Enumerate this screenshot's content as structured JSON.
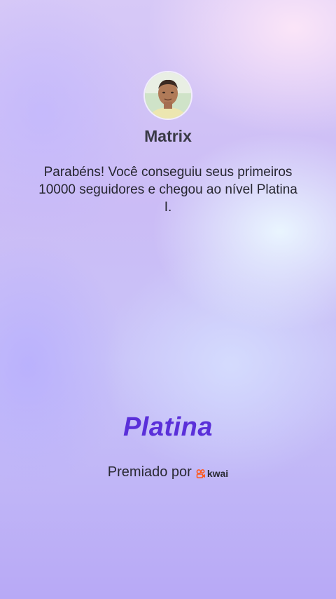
{
  "profile": {
    "name": "Matrix",
    "avatar_icon": "user-avatar"
  },
  "message": {
    "text": "Parabéns! Você conseguiu seus primeiros 10000 seguidores e chegou ao nível Platina I."
  },
  "tier": {
    "label": "Platina",
    "color": "#5a2fd9"
  },
  "sponsor": {
    "prefix": "Premiado por",
    "brand": "kwai",
    "brand_icon": "kwai-logo-icon",
    "brand_color": "#ff5a1f"
  }
}
